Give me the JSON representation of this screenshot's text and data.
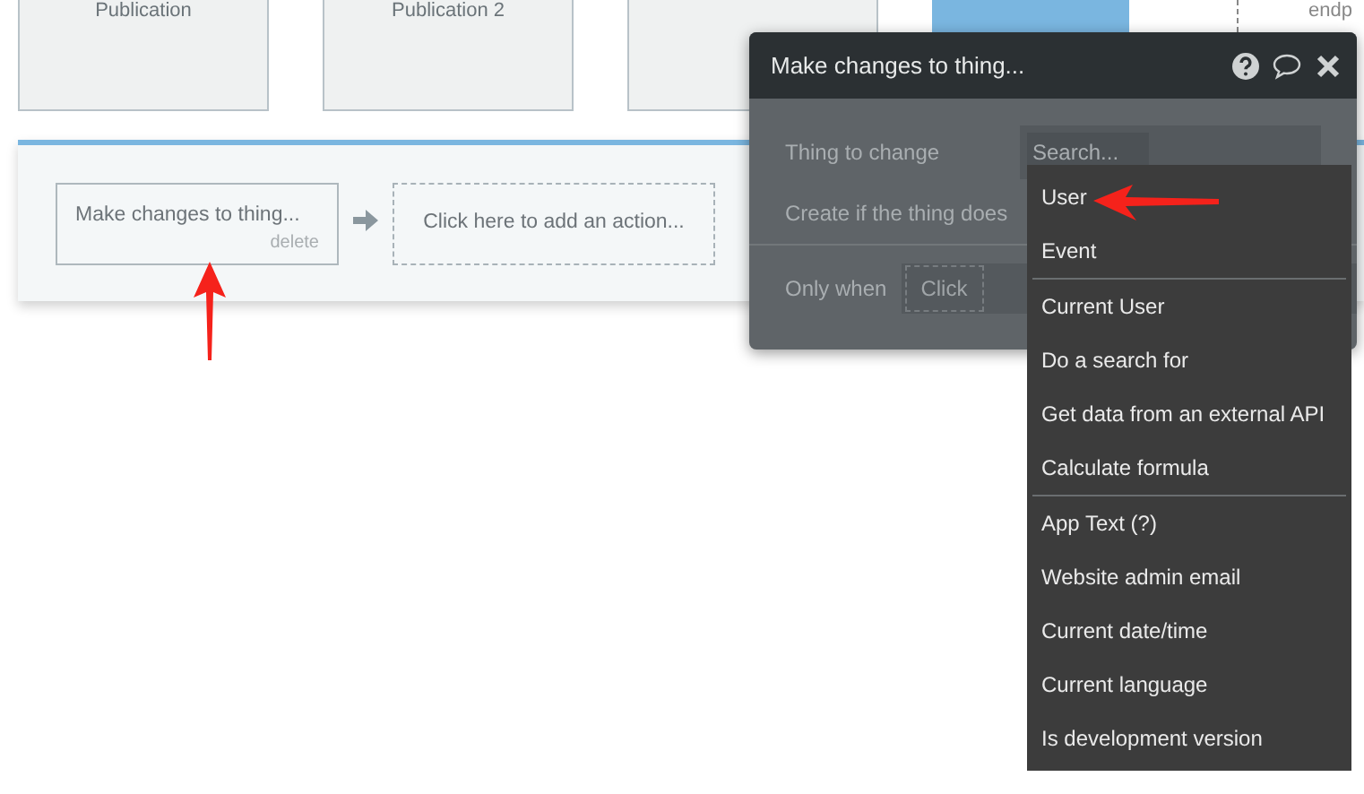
{
  "canvas": {
    "cards": [
      {
        "label": "Publication"
      },
      {
        "label": "Publication 2"
      }
    ],
    "endpoint_text": "endp"
  },
  "workflow": {
    "actions": [
      {
        "label": "Make changes to thing...",
        "delete_label": "delete"
      }
    ],
    "add_action": "Click here to add an action..."
  },
  "popup": {
    "title": "Make changes to thing...",
    "fields": [
      {
        "label": "Thing to change",
        "placeholder": "Search..."
      }
    ],
    "create_label": "Create if the thing does",
    "only_when_label": "Only when",
    "only_when_value": "Click"
  },
  "dropdown": {
    "groups": [
      {
        "items": [
          "User",
          "Event"
        ]
      },
      {
        "items": [
          "Current User",
          "Do a search for",
          "Get data from an external API",
          "Calculate formula"
        ]
      },
      {
        "items": [
          "App Text (?)",
          "Website admin email",
          "Current date/time",
          "Current language",
          "Is development version"
        ]
      }
    ]
  }
}
